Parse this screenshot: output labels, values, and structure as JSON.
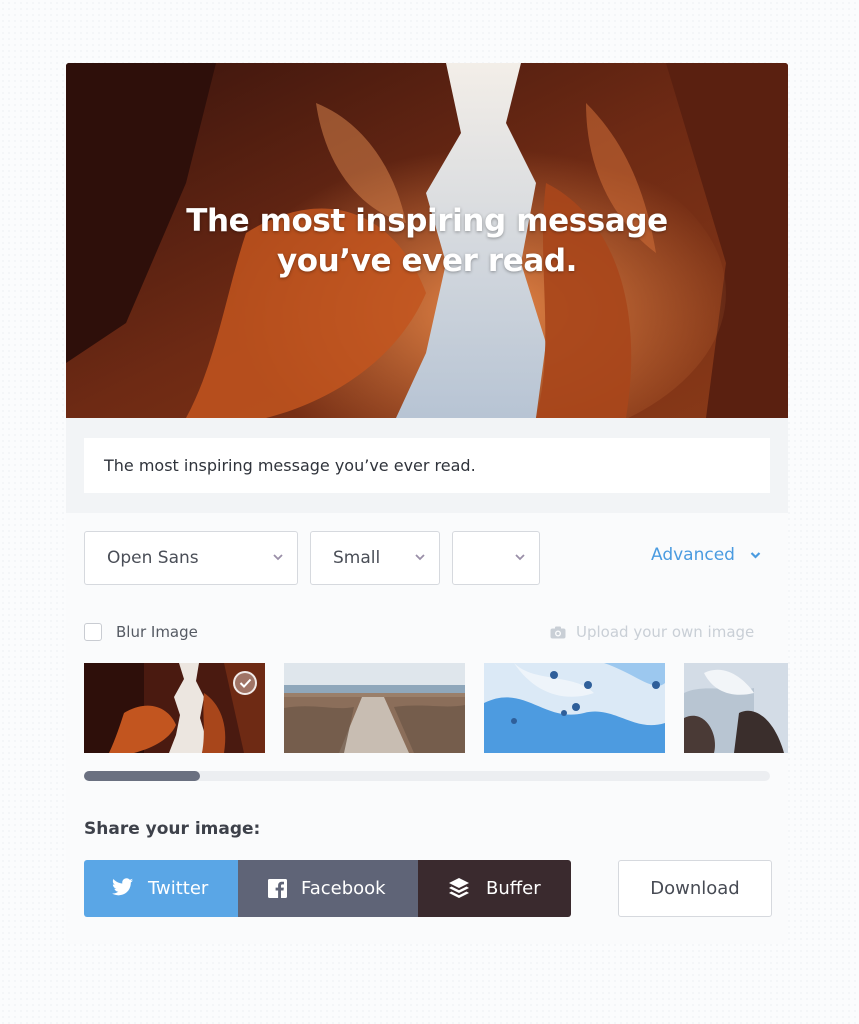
{
  "hero": {
    "line1": "The most inspiring message",
    "line2": "you’ve ever read."
  },
  "message_input": {
    "value": "The most inspiring message you’ve ever read."
  },
  "controls": {
    "font_select": {
      "value": "Open Sans"
    },
    "size_select": {
      "value": "Small"
    },
    "color_select": {
      "value": ""
    },
    "advanced_label": "Advanced"
  },
  "options": {
    "blur_label": "Blur Image",
    "blur_checked": false,
    "upload_label": "Upload your own image"
  },
  "thumbnails": [
    {
      "name": "canyon",
      "selected": true
    },
    {
      "name": "boardwalk-beach",
      "selected": false
    },
    {
      "name": "blue-sky-balloons",
      "selected": false
    },
    {
      "name": "snowy-rocks",
      "selected": false
    }
  ],
  "scroll": {
    "position_fraction": 0.0,
    "visible_fraction": 0.17
  },
  "share": {
    "heading": "Share your image:",
    "twitter_label": "Twitter",
    "facebook_label": "Facebook",
    "buffer_label": "Buffer",
    "download_label": "Download"
  },
  "colors": {
    "accent": "#4a9be0",
    "twitter": "#5aa6e6",
    "facebook": "#5f6477",
    "buffer": "#3a2a2e"
  }
}
